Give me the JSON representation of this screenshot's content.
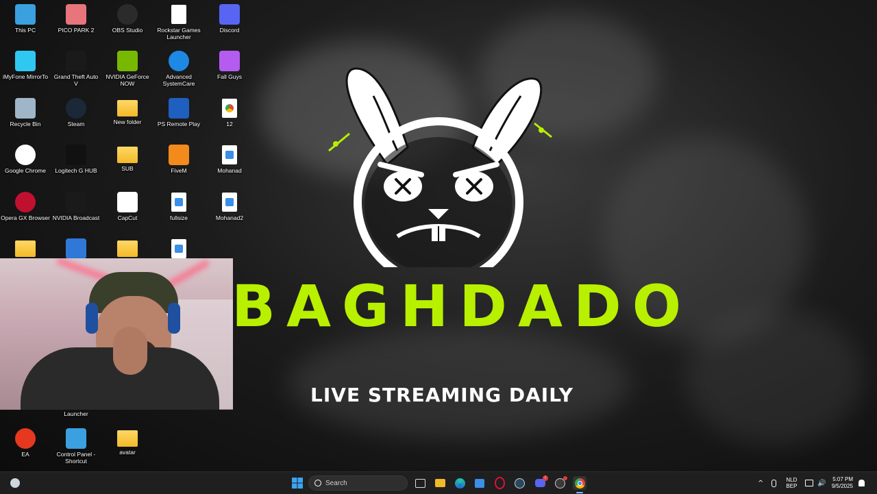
{
  "desktop_icons": [
    {
      "label": "This PC",
      "icon": "computer-icon",
      "color": "#3aa0e0"
    },
    {
      "label": "PICO PARK 2",
      "icon": "pico-park-icon",
      "color": "#e8747c"
    },
    {
      "label": "OBS Studio",
      "icon": "obs-icon",
      "color": "#2b2b2b"
    },
    {
      "label": "Rockstar Games Launcher",
      "icon": "file-icon",
      "color": "#ffffff"
    },
    {
      "label": "Discord",
      "icon": "discord-icon",
      "color": "#5865f2"
    },
    {
      "label": "iMyFone MirrorTo",
      "icon": "mirrorto-icon",
      "color": "#30c8f0"
    },
    {
      "label": "Grand Theft Auto V",
      "icon": "gta-icon",
      "color": "#1a1a1a"
    },
    {
      "label": "NVIDIA GeForce NOW",
      "icon": "nvidia-icon",
      "color": "#76b900"
    },
    {
      "label": "Advanced SystemCare",
      "icon": "advanced-systemcare-icon",
      "color": "#1e88e5"
    },
    {
      "label": "Fall Guys",
      "icon": "fall-guys-icon",
      "color": "#b45cf0"
    },
    {
      "label": "Recycle Bin",
      "icon": "recycle-bin-icon",
      "color": "#9fb6c8"
    },
    {
      "label": "Steam",
      "icon": "steam-icon",
      "color": "#1b2838"
    },
    {
      "label": "New folder",
      "icon": "folder-icon",
      "color": "#f2b928"
    },
    {
      "label": "PS Remote Play",
      "icon": "ps-remote-play-icon",
      "color": "#1f5fbf"
    },
    {
      "label": "12",
      "icon": "chrome-file-icon",
      "color": "#ffffff"
    },
    {
      "label": "Google Chrome",
      "icon": "chrome-icon",
      "color": "#ffffff"
    },
    {
      "label": "Logitech G HUB",
      "icon": "logitech-icon",
      "color": "#111111"
    },
    {
      "label": "SUB",
      "icon": "folder-icon",
      "color": "#f2b928"
    },
    {
      "label": "FiveM",
      "icon": "fivem-icon",
      "color": "#f28a1c"
    },
    {
      "label": "Mohanad",
      "icon": "image-file-icon",
      "color": "#ffffff"
    },
    {
      "label": "Opera GX Browser",
      "icon": "opera-gx-icon",
      "color": "#c0102f"
    },
    {
      "label": "NVIDIA Broadcast",
      "icon": "nvidia-broadcast-icon",
      "color": "#1a1a1a"
    },
    {
      "label": "CapCut",
      "icon": "capcut-icon",
      "color": "#ffffff"
    },
    {
      "label": "fullsize",
      "icon": "image-file-icon",
      "color": "#ffffff"
    },
    {
      "label": "Mohanad2",
      "icon": "image-file-icon",
      "color": "#ffffff"
    },
    {
      "label": "",
      "icon": "folder-icon",
      "color": "#f2b928"
    },
    {
      "label": "",
      "icon": "rocket-league-icon",
      "color": "#2f78d8"
    },
    {
      "label": "",
      "icon": "folder-icon",
      "color": "#f2b928"
    },
    {
      "label": "",
      "icon": "image-file-icon",
      "color": "#ffffff"
    },
    {
      "label": "Launcher",
      "icon": "",
      "color": ""
    },
    {
      "label": "EA",
      "icon": "ea-icon",
      "color": "#e5381f"
    },
    {
      "label": "Control Panel - Shortcut",
      "icon": "control-panel-icon",
      "color": "#3aa0e0"
    },
    {
      "label": "avatar",
      "icon": "folder-icon",
      "color": "#f2b928"
    }
  ],
  "wallpaper": {
    "brand": "BAGHDADO",
    "tagline": "LIVE STREAMING DAILY",
    "accent": "#b8f000",
    "logo": "angry-rabbit-logo"
  },
  "webcam": {
    "label": "webcam-overlay"
  },
  "taskbar": {
    "search_placeholder": "Search",
    "lang_top": "NLD",
    "lang_bottom": "BEP",
    "time": "5:07 PM",
    "date": "9/5/2025",
    "discord_badge": "!"
  }
}
